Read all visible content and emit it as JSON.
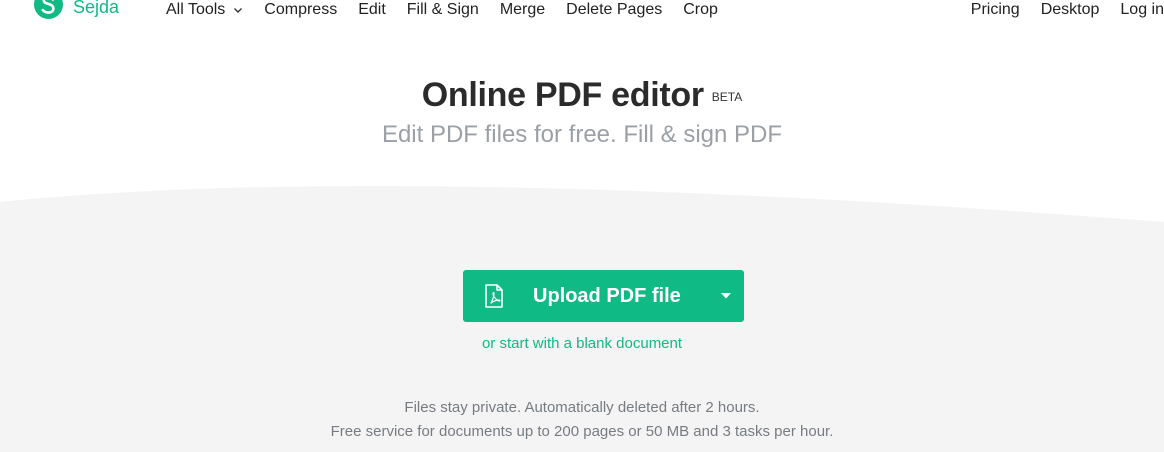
{
  "brand": {
    "name": "Sejda",
    "color": "#0fba85"
  },
  "nav": {
    "items": [
      {
        "label": "All Tools",
        "icon": "chevron-down-icon"
      },
      {
        "label": "Compress"
      },
      {
        "label": "Edit"
      },
      {
        "label": "Fill & Sign"
      },
      {
        "label": "Merge"
      },
      {
        "label": "Delete Pages"
      },
      {
        "label": "Crop"
      }
    ],
    "right_items": [
      {
        "label": "Pricing"
      },
      {
        "label": "Desktop"
      },
      {
        "label": "Log in"
      }
    ]
  },
  "hero": {
    "title": "Online PDF editor",
    "badge": "BETA",
    "subtitle": "Edit PDF files for free. Fill & sign PDF"
  },
  "upload": {
    "button_label": "Upload PDF file",
    "icon": "pdf-file-icon",
    "dropdown_icon": "caret-down-icon",
    "blank_link": "or start with a blank document"
  },
  "info": {
    "line1": "Files stay private. Automatically deleted after 2 hours.",
    "line2": "Free service for documents up to 200 pages or 50 MB and 3 tasks per hour."
  },
  "colors": {
    "accent": "#0fba85",
    "background_grey": "#f4f4f4",
    "title": "#2b2b2b",
    "subtitle": "#9aa0a6",
    "info_text": "#777c82"
  }
}
